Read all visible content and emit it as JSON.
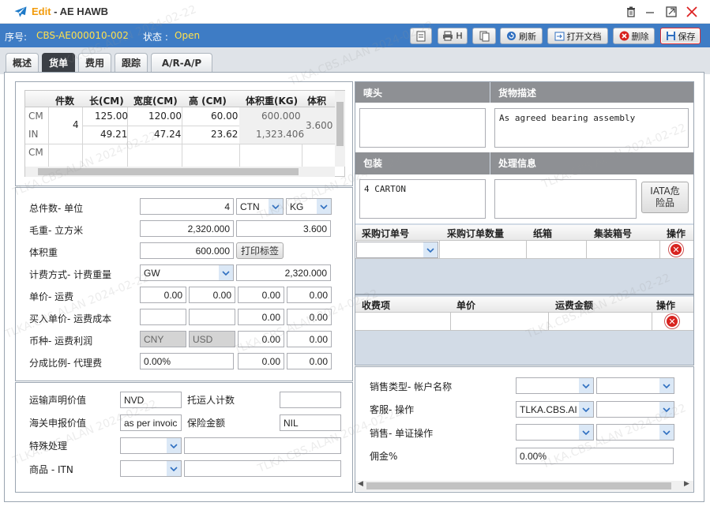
{
  "window": {
    "title_prefix": "Edit",
    "title_sep": " - ",
    "title": "AE HAWB"
  },
  "header": {
    "serial_label": "序号:",
    "serial_value": "CBS-AE000010-002",
    "status_label": "状态 :",
    "status_value": "Open",
    "buttons": {
      "print_h": "H",
      "refresh": "刷新",
      "open_doc": "打开文档",
      "delete": "删除",
      "save": "保存"
    }
  },
  "tabs": [
    "概述",
    "货单",
    "费用",
    "跟踪",
    "A/R-A/P"
  ],
  "dims_table": {
    "headers": [
      "件数",
      "长(CM)",
      "宽度(CM)",
      "高 (CM)",
      "体积重(KG)",
      "体积"
    ],
    "rows": [
      {
        "unit": "CM",
        "pieces": "4",
        "length": "125.00",
        "width": "120.00",
        "height": "60.00",
        "vol_weight": "600.000",
        "volume": "3.600"
      },
      {
        "unit": "IN",
        "pieces": "",
        "length": "49.21",
        "width": "47.24",
        "height": "23.62",
        "vol_weight": "1,323.406",
        "volume": ""
      },
      {
        "unit": "CM",
        "pieces": "",
        "length": "",
        "width": "",
        "height": "",
        "vol_weight": "",
        "volume": ""
      }
    ]
  },
  "form": {
    "pieces_unit_label": "总件数- 单位",
    "pieces": "4",
    "pieces_unit": "CTN",
    "weight_unit": "KG",
    "gross_vol_label": "毛重- 立方米",
    "gross_weight": "2,320.000",
    "cbm": "3.600",
    "vol_weight_label": "体积重",
    "vol_weight": "600.000",
    "print_label_btn": "打印标签",
    "charge_method_label": "计费方式- 计费重量",
    "charge_method": "GW",
    "charge_weight": "2,320.000",
    "unit_price_label": "单价- 运费",
    "unit_price_values": [
      "0.00",
      "0.00",
      "0.00",
      "0.00"
    ],
    "buy_price_label": "买入单价- 运费成本",
    "buy_price_values": [
      "",
      "",
      "0.00",
      "0.00"
    ],
    "currency_label": "币种- 运费利润",
    "currency1": "CNY",
    "currency2": "USD",
    "currency_values": [
      "0.00",
      "0.00"
    ],
    "split_label": "分成比例- 代理费",
    "split_ratio": "0.00%",
    "split_values": [
      "0.00",
      "0.00"
    ]
  },
  "lower_left": {
    "carriage_value_label": "运输声明价值",
    "carriage_value": "NVD",
    "shipper_count_label": "托运人计数",
    "shipper_count": "",
    "customs_value_label": "海关申报价值",
    "customs_value": "as per invoic",
    "insurance_label": "保险金额",
    "insurance": "NIL",
    "special_label": "特殊处理",
    "goods_label": "商品 - ITN"
  },
  "right": {
    "marks_label": "唛头",
    "goods_desc_label": "货物描述",
    "goods_desc": "As agreed bearing assembly",
    "packing_label": "包装",
    "packing": "4 CARTON",
    "handling_label": "处理信息",
    "iata_btn_line1": "IATA危",
    "iata_btn_line2": "险品",
    "po_headers": [
      "采购订单号",
      "采购订单数量",
      "纸箱",
      "集装箱号",
      "操作"
    ],
    "charge_headers": [
      "收费项",
      "单价",
      "运费金额",
      "操作"
    ],
    "sales_type_label": "销售类型- 帐户名称",
    "cs_label": "客服- 操作",
    "cs_value": "TLKA.CBS.AI",
    "sales_label": "销售- 单证操作",
    "commission_label": "佣金%",
    "commission": "0.00%"
  },
  "watermark": "TLKA.CBS.ALAN 2024-02-22"
}
